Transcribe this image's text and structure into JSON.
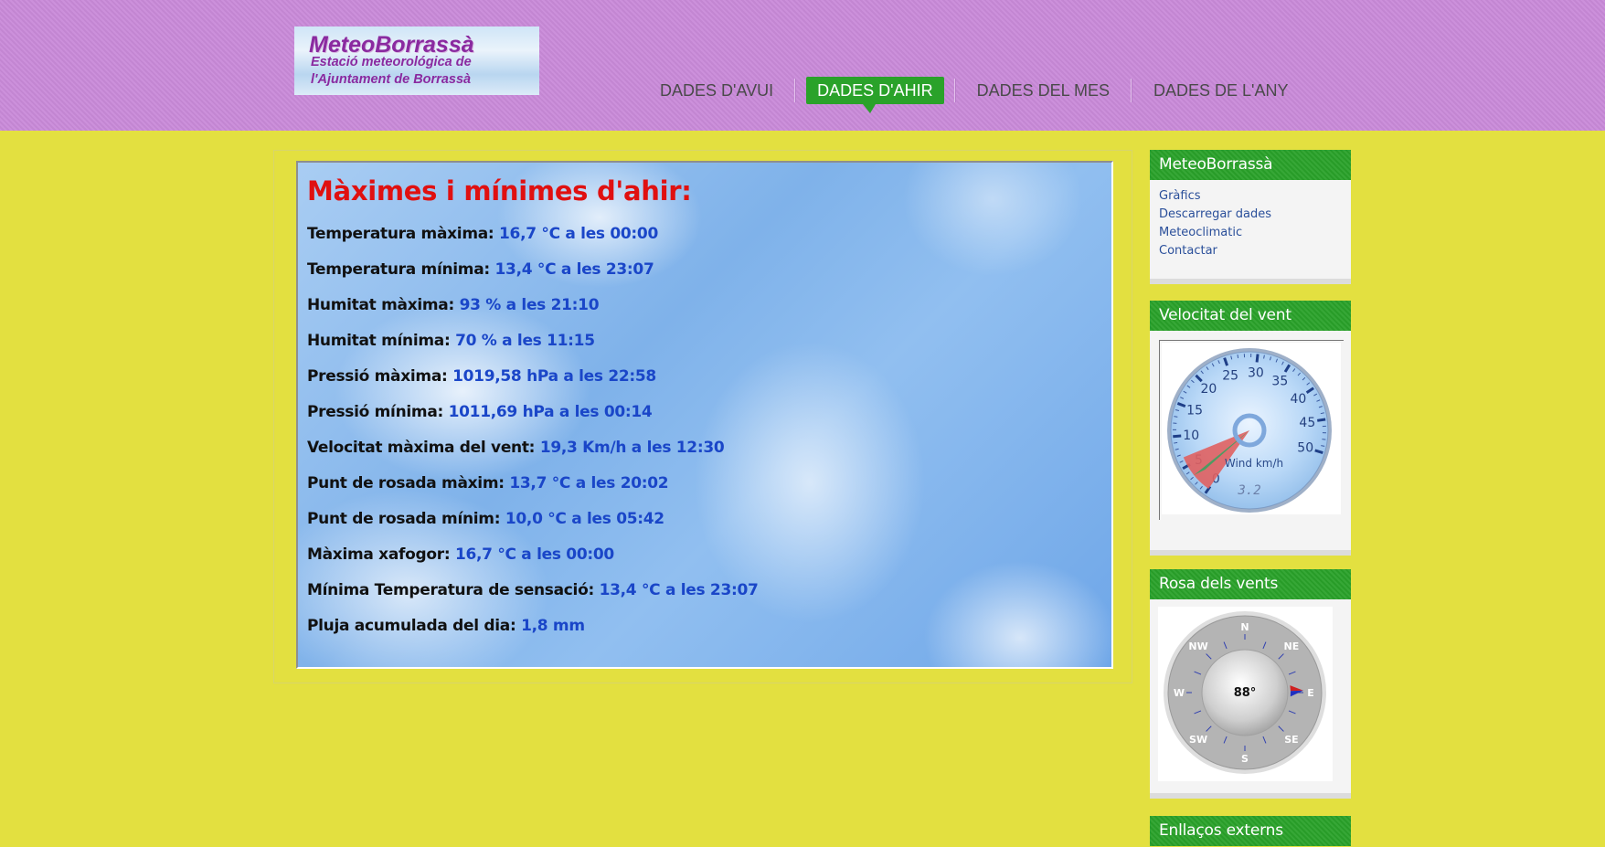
{
  "logo": {
    "line1": "MeteoBorrassà",
    "line2": "Estació meteorológica de",
    "line3": "l'Ajuntament de Borrassà"
  },
  "nav": [
    {
      "label": "DADES D'AVUI",
      "active": false
    },
    {
      "label": "DADES D'AHIR",
      "active": true
    },
    {
      "label": "DADES DEL MES",
      "active": false
    },
    {
      "label": "DADES DE L'ANY",
      "active": false
    }
  ],
  "main": {
    "title": "Màximes i mínimes d'ahir:",
    "rows": [
      {
        "label": "Temperatura màxima:",
        "value": "16,7 °C a les 00:00"
      },
      {
        "label": "Temperatura mínima:",
        "value": "13,4 °C a les 23:07"
      },
      {
        "label": "Humitat màxima:",
        "value": "93 % a les 21:10"
      },
      {
        "label": "Humitat mínima:",
        "value": "70 % a les 11:15"
      },
      {
        "label": "Pressió màxima:",
        "value": "1019,58 hPa a les 22:58"
      },
      {
        "label": "Pressió mínima:",
        "value": "1011,69 hPa a les 00:14"
      },
      {
        "label": "Velocitat màxima del vent:",
        "value": "19,3 Km/h a les 12:30"
      },
      {
        "label": "Punt de rosada màxim:",
        "value": "13,7 °C a les 20:02"
      },
      {
        "label": "Punt de rosada mínim:",
        "value": "10,0 °C a les 05:42"
      },
      {
        "label": "Màxima xafogor:",
        "value": "16,7 °C a les 00:00"
      },
      {
        "label": "Mínima Temperatura de sensació:",
        "value": "13,4 °C a les 23:07"
      },
      {
        "label": "Pluja acumulada del dia:",
        "value": "1,8 mm"
      }
    ]
  },
  "sidebar": {
    "meteo": {
      "title": "MeteoBorrassà",
      "links": [
        "Gràfics",
        "Descarregar dades",
        "Meteoclimatic",
        "Contactar"
      ]
    },
    "wind_speed": {
      "title": "Velocitat del vent",
      "gauge": {
        "ticks": [
          "0",
          "5",
          "10",
          "15",
          "20",
          "25",
          "30",
          "35",
          "40",
          "45",
          "50"
        ],
        "unit_label": "Wind km/h",
        "value": 3.2,
        "value_text": "3.2",
        "min": 0,
        "max": 50
      }
    },
    "wind_rose": {
      "title": "Rosa dels vents",
      "directions": [
        "N",
        "NE",
        "E",
        "SE",
        "S",
        "SW",
        "W",
        "NW"
      ],
      "bearing_deg": 88,
      "bearing_text": "88°"
    },
    "links_ext": {
      "title": "Enllaços externs"
    }
  },
  "colors": {
    "header_bg": "#c98ad9",
    "page_bg": "#e3e040",
    "accent_green": "#2aa22a",
    "title_red": "#e01010",
    "value_blue": "#1a46c8"
  }
}
